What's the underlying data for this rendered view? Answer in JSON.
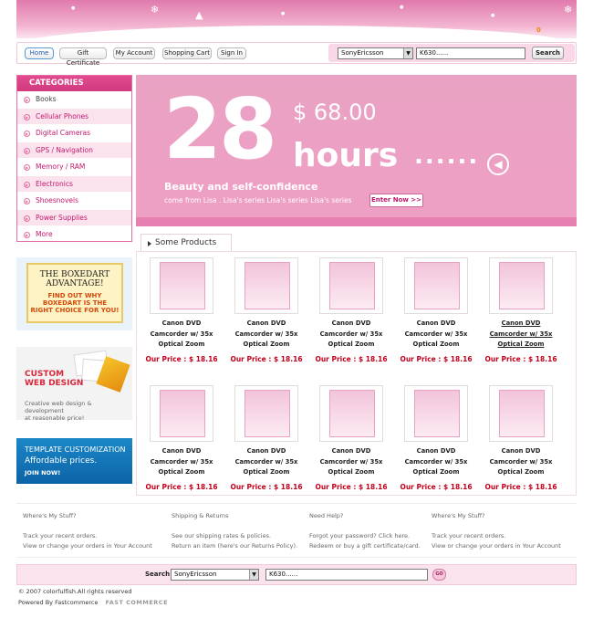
{
  "header": {
    "cart_count": "0"
  },
  "nav": {
    "buttons": [
      "Home",
      "Gift Certificate",
      "My Account",
      "Shopping Cart",
      "Sign In"
    ],
    "search_category": "SonyEricsson",
    "search_value": "K630......",
    "search_button": "Search"
  },
  "sidebar": {
    "title": "CATEGORIES",
    "items": [
      "Books",
      "Cellular Phones",
      "Digital Cameras",
      "GPS / Navigation",
      "Memory / RAM",
      "Electronics",
      "Shoesnovels",
      "Power Supplies",
      "More"
    ]
  },
  "ads": {
    "boxedart": {
      "title1": "THE BOXEDART",
      "title2": "ADVANTAGE!",
      "line1": "FIND OUT WHY",
      "line2": "BOXEDART IS THE",
      "line3": "RIGHT CHOICE FOR YOU!"
    },
    "webdesign": {
      "title1": "CUSTOM",
      "title2": "WEB DESIGN",
      "desc1": "Creative web design & development",
      "desc2": "at reasonable price!"
    },
    "template": {
      "line1": "TEMPLATE CUSTOMIZATION",
      "line2": "Affordable prices.",
      "line3": "JOIN NOW!"
    }
  },
  "banner": {
    "big_number": "28",
    "price": "$ 68.00",
    "hours": "hours",
    "dots": "......",
    "tagline": "Beauty and self-confidence",
    "subline": "come from Lisa . Lisa's series Lisa's series Lisa's series",
    "enter_label": "Enter Now >>"
  },
  "products": {
    "tab_label": "Some Products",
    "items": [
      {
        "name1": "Canon DVD",
        "name2": "Camcorder w/ 35x",
        "name3": "Optical Zoom",
        "price": "Our Price : $ 18.16"
      },
      {
        "name1": "Canon DVD",
        "name2": "Camcorder w/ 35x",
        "name3": "Optical Zoom",
        "price": "Our Price : $ 18.16"
      },
      {
        "name1": "Canon DVD",
        "name2": "Camcorder w/ 35x",
        "name3": "Optical Zoom",
        "price": "Our Price : $ 18.16"
      },
      {
        "name1": "Canon DVD",
        "name2": "Camcorder w/ 35x",
        "name3": "Optical Zoom",
        "price": "Our Price : $ 18.16"
      },
      {
        "name1": "Canon DVD",
        "name2": "Camcorder w/ 35x",
        "name3": "Optical Zoom",
        "price": "Our Price : $ 18.16"
      },
      {
        "name1": "Canon DVD",
        "name2": "Camcorder w/ 35x",
        "name3": "Optical Zoom",
        "price": "Our Price : $ 18.16"
      },
      {
        "name1": "Canon DVD",
        "name2": "Camcorder w/ 35x",
        "name3": "Optical Zoom",
        "price": "Our Price : $ 18.16"
      },
      {
        "name1": "Canon DVD",
        "name2": "Camcorder w/ 35x",
        "name3": "Optical Zoom",
        "price": "Our Price : $ 18.16"
      },
      {
        "name1": "Canon DVD",
        "name2": "Camcorder w/ 35x",
        "name3": "Optical Zoom",
        "price": "Our Price : $ 18.16"
      },
      {
        "name1": "Canon DVD",
        "name2": "Camcorder w/ 35x",
        "name3": "Optical Zoom",
        "price": "Our Price : $ 18.16"
      }
    ]
  },
  "footer": {
    "cols": [
      {
        "heading": "Where's My Stuff?",
        "l1": "Track your recent orders.",
        "l2": "View or change your orders in Your Account"
      },
      {
        "heading": "Shipping & Returns",
        "l1": "See our shipping rates & policies.",
        "l2": "Return an item (here's our Returns Policy)."
      },
      {
        "heading": "Need Help?",
        "l1": "Forgot your password? Click here.",
        "l2": "Redeem or buy a gift certificate/card."
      },
      {
        "heading": "Where's My Stuff?",
        "l1": "Track your recent orders.",
        "l2": "View or change your orders in Your Account"
      }
    ],
    "search_label": "Search",
    "search_category": "SonyEricsson",
    "search_value": "K630......",
    "go_label": "GO",
    "copyright": "© 2007 colorfulfish.All rights reserved",
    "powered": "Powered  By Fastcommerce",
    "powered_logo": "FAST COMMERCE"
  },
  "colors": {
    "accent": "#e46ea4",
    "price": "#c3001b",
    "header_pink": "#e07aac"
  }
}
